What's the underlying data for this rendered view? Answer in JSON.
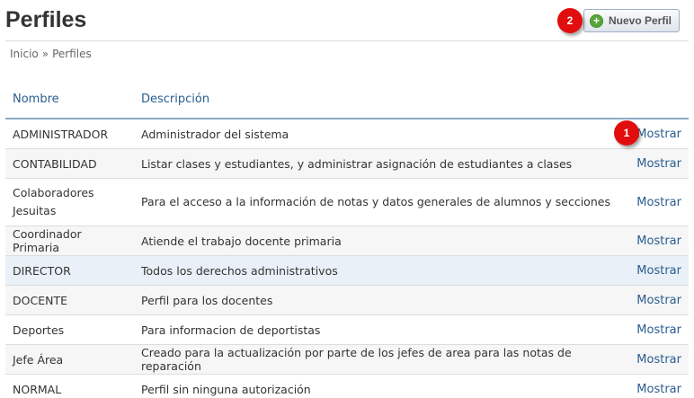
{
  "page": {
    "title": "Perfiles",
    "new_button_label": "Nuevo Perfil"
  },
  "breadcrumb": {
    "home": "Inicio",
    "separator": "»",
    "current": "Perfiles"
  },
  "markers": [
    "1",
    "2"
  ],
  "table": {
    "headers": {
      "name": "Nombre",
      "description": "Descripción"
    },
    "action_label": "Mostrar",
    "rows": [
      {
        "name": "ADMINISTRADOR",
        "description": "Administrador del sistema"
      },
      {
        "name": "CONTABILIDAD",
        "description": "Listar clases y estudiantes, y administrar asignación de estudiantes a clases"
      },
      {
        "name": "Colaboradores Jesuitas",
        "description": "Para el acceso a la información de notas y datos generales de alumnos y secciones"
      },
      {
        "name": "Coordinador Primaria",
        "description": "Atiende el trabajo docente primaria"
      },
      {
        "name": "DIRECTOR",
        "description": "Todos los derechos administrativos"
      },
      {
        "name": "DOCENTE",
        "description": "Perfil para los docentes"
      },
      {
        "name": "Deportes",
        "description": "Para informacion de deportistas"
      },
      {
        "name": "Jefe Área",
        "description": "Creado para la actualización por parte de los jefes de area para las notas de reparación"
      },
      {
        "name": "NORMAL",
        "description": "Perfil sin ninguna autorización"
      }
    ]
  }
}
